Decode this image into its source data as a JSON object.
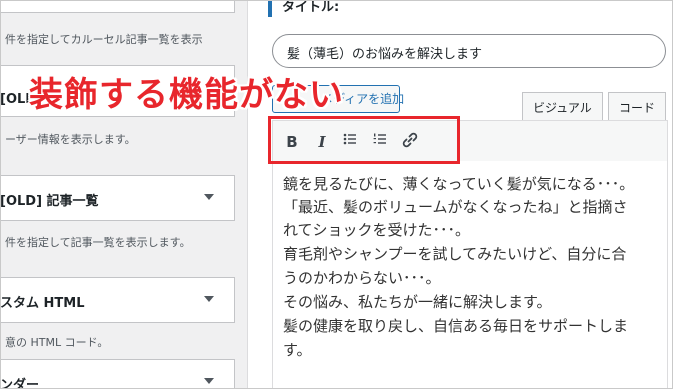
{
  "left_panel": {
    "desc_1": "件を指定してカルーセル記事一覧を表示",
    "widget_1_title": "[OLD]",
    "desc_2": "ーザー情報を表示します。",
    "widget_2_title": "[OLD] 記事一覧",
    "desc_3": "件を指定して記事一覧を表示します。",
    "widget_3_title": "スタム HTML",
    "desc_4": "意の HTML コード。",
    "widget_4_title": "ンダー"
  },
  "editor": {
    "field_label": "タイトル:",
    "title_value": "髪（薄毛）のお悩みを解決します",
    "add_media_label": "メディアを追加",
    "tab_visual": "ビジュアル",
    "tab_code": "コード",
    "toolbar": [
      {
        "name": "bold-button",
        "glyph": "B"
      },
      {
        "name": "italic-button",
        "glyph": "I"
      },
      {
        "name": "bulleted-list-button",
        "glyph": "≔"
      },
      {
        "name": "numbered-list-button",
        "glyph": "⒈"
      },
      {
        "name": "insert-link-button",
        "glyph": "🔗"
      }
    ],
    "content_lines": [
      "鏡を見るたびに、薄くなっていく髪が気になる･･･。",
      "「最近、髪のボリュームがなくなったね」と指摘さ",
      "れてショックを受けた･･･。",
      "育毛剤やシャンプーを試してみたいけど、自分に合",
      "うのかわからない･･･。",
      "その悩み、私たちが一緒に解決します。",
      "髪の健康を取り戻し、自信ある毎日をサポートしま",
      "す。"
    ]
  },
  "annotation": {
    "callout_text": "装飾する機能がない",
    "color": "#e8262c"
  }
}
